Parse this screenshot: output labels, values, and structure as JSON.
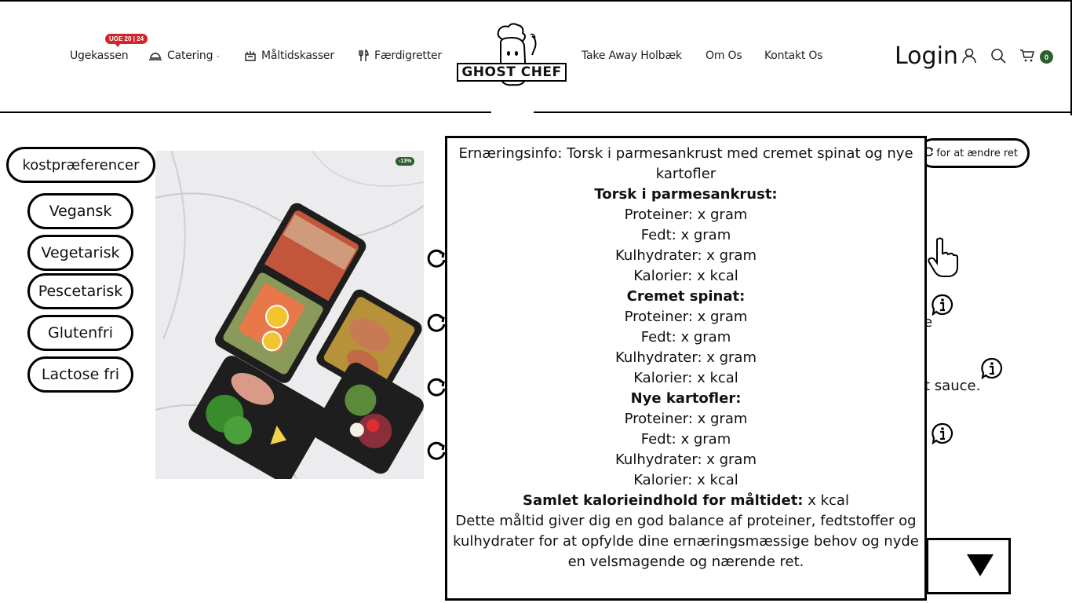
{
  "header": {
    "nav_left": [
      {
        "label": "Ugekassen",
        "badge": "UGE 20 | 24"
      },
      {
        "label": "Catering",
        "has_dropdown": true
      },
      {
        "label": "Måltidskasser"
      },
      {
        "label": "Færdigretter"
      }
    ],
    "logo_text": "GHOST CHEF",
    "nav_right": [
      {
        "label": "Take Away Holbæk"
      },
      {
        "label": "Om Os"
      },
      {
        "label": "Kontakt Os"
      }
    ],
    "login_label": "Login",
    "cart_count": "0"
  },
  "filters": {
    "title": "kostpræferencer",
    "options": [
      "Vegansk",
      "Vegetarisk",
      "Pescetarisk",
      "Glutenfri",
      "Lactose fri"
    ]
  },
  "product": {
    "discount_badge": "-13%"
  },
  "right_panel": {
    "change_label": "for at ændre ret",
    "partial_text_1": "e",
    "partial_text_2": "t sauce."
  },
  "modal": {
    "title": "Ernæringsinfo: Torsk i parmesankrust med cremet spinat og nye kartofler",
    "sections": [
      {
        "heading": "Torsk i parmesankrust:",
        "lines": [
          "Proteiner: x gram",
          "Fedt: x gram",
          "Kulhydrater: x gram",
          "Kalorier: x kcal"
        ]
      },
      {
        "heading": "Cremet spinat:",
        "lines": [
          "Proteiner: x gram",
          "Fedt: x gram",
          "Kulhydrater: x gram",
          "Kalorier: x kcal"
        ]
      },
      {
        "heading": "Nye kartofler:",
        "lines": [
          "Proteiner: x gram",
          "Fedt: x gram",
          "Kulhydrater: x gram",
          "Kalorier: x kcal"
        ]
      }
    ],
    "total_label": "Samlet kalorieindhold for måltidet:",
    "total_value": " x kcal",
    "summary": "Dette måltid giver dig en god balance af proteiner, fedtstoffer og kulhydrater for at opfylde dine ernæringsmæssige behov og nyde en velsmagende og nærende ret."
  },
  "colors": {
    "accent_green": "#2e5d2e",
    "badge_red": "#d4232a",
    "border": "#000000"
  }
}
